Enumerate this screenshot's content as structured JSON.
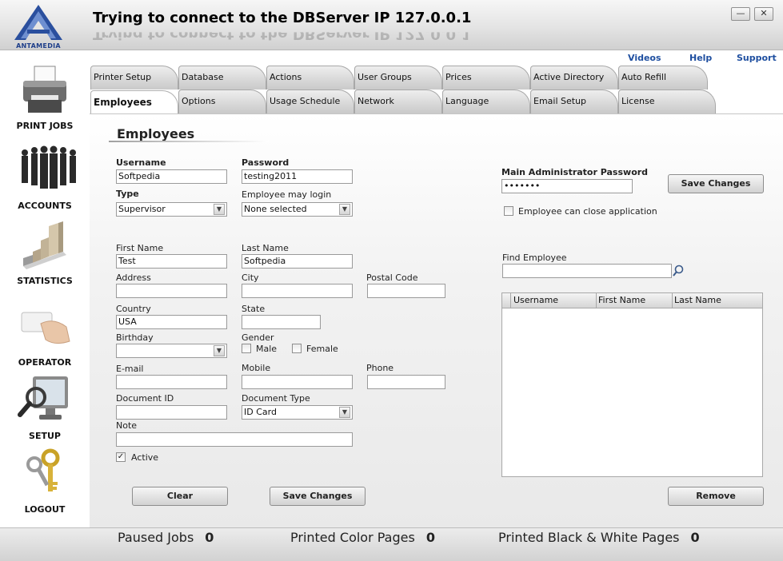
{
  "window": {
    "title": "Trying to connect to the DBServer IP 127.0.0.1",
    "logo_text": "ANTAMEDIA",
    "minimize_glyph": "—",
    "close_glyph": "✕"
  },
  "sidebar": {
    "items": [
      {
        "label": "PRINT JOBS",
        "icon": "printer-icon"
      },
      {
        "label": "ACCOUNTS",
        "icon": "people-icon"
      },
      {
        "label": "STATISTICS",
        "icon": "bar-chart-icon"
      },
      {
        "label": "OPERATOR",
        "icon": "card-hand-icon"
      },
      {
        "label": "SETUP",
        "icon": "monitor-magnifier-icon"
      },
      {
        "label": "LOGOUT",
        "icon": "keys-icon"
      }
    ]
  },
  "top_links": {
    "videos": "Videos",
    "help": "Help",
    "support": "Support"
  },
  "tabs": {
    "row1": [
      "Printer Setup",
      "Database",
      "Actions",
      "User Groups",
      "Prices",
      "Active Directory",
      "Auto Refill"
    ],
    "row2": [
      "Employees",
      "Options",
      "Usage Schedule",
      "Network",
      "Language",
      "Email Setup",
      "License"
    ],
    "active": "Employees"
  },
  "form": {
    "section_title": "Employees",
    "username_label": "Username",
    "username_value": "Softpedia",
    "password_label": "Password",
    "password_value": "testing2011",
    "type_label": "Type",
    "type_value": "Supervisor",
    "may_login_label": "Employee may login",
    "may_login_value": "None selected",
    "first_name_label": "First Name",
    "first_name_value": "Test",
    "last_name_label": "Last Name",
    "last_name_value": "Softpedia",
    "address_label": "Address",
    "address_value": "",
    "city_label": "City",
    "city_value": "",
    "postal_label": "Postal Code",
    "postal_value": "",
    "country_label": "Country",
    "country_value": "USA",
    "state_label": "State",
    "state_value": "",
    "birthday_label": "Birthday",
    "birthday_value": "",
    "gender_label": "Gender",
    "male_label": "Male",
    "female_label": "Female",
    "email_label": "E-mail",
    "email_value": "",
    "mobile_label": "Mobile",
    "mobile_value": "",
    "phone_label": "Phone",
    "phone_value": "",
    "doc_id_label": "Document ID",
    "doc_id_value": "",
    "doc_type_label": "Document Type",
    "doc_type_value": "ID Card",
    "note_label": "Note",
    "note_value": "",
    "active_label": "Active",
    "active_checked": "✓",
    "clear_label": "Clear",
    "save_label": "Save Changes"
  },
  "admin": {
    "password_label": "Main Administrator Password",
    "password_value": "•••••••",
    "save_label": "Save Changes",
    "can_close_label": "Employee can close application",
    "find_label": "Find Employee",
    "find_value": "",
    "columns": [
      "Username",
      "First Name",
      "Last Name"
    ],
    "remove_label": "Remove"
  },
  "status": {
    "paused_label": "Paused Jobs",
    "paused_value": "0",
    "color_label": "Printed Color Pages",
    "color_value": "0",
    "bw_label": "Printed Black & White Pages",
    "bw_value": "0"
  }
}
